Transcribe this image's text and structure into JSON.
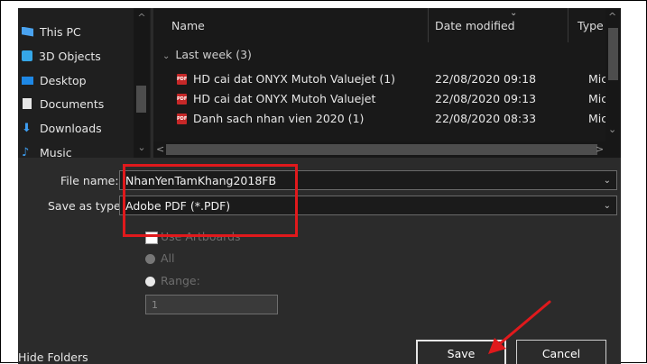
{
  "nav": {
    "items": [
      {
        "label": "This PC",
        "icon": "computer-icon"
      },
      {
        "label": "3D Objects",
        "icon": "cube-icon"
      },
      {
        "label": "Desktop",
        "icon": "desktop-icon"
      },
      {
        "label": "Documents",
        "icon": "document-icon"
      },
      {
        "label": "Downloads",
        "icon": "download-arrow-icon"
      },
      {
        "label": "Music",
        "icon": "music-note-icon"
      }
    ]
  },
  "list": {
    "columns": [
      "Name",
      "Date modified",
      "Type"
    ],
    "group_label": "Last week (3)",
    "rows": [
      {
        "name": "HD cai dat ONYX Mutoh Valuejet (1)",
        "date": "22/08/2020 09:18",
        "type": "Micro"
      },
      {
        "name": "HD cai dat ONYX Mutoh Valuejet",
        "date": "22/08/2020 09:13",
        "type": "Micro"
      },
      {
        "name": "Danh sach nhan vien 2020 (1)",
        "date": "22/08/2020 08:33",
        "type": "Micro"
      }
    ]
  },
  "form": {
    "file_name_label": "File name:",
    "file_name_value": "NhanYenTamKhang2018FB",
    "save_type_label": "Save as type:",
    "save_type_value": "Adobe PDF (*.PDF)",
    "use_artboards_label": "Use Artboards",
    "all_label": "All",
    "range_label": "Range:",
    "range_value": "1"
  },
  "footer": {
    "hide_folders": "Hide Folders",
    "save": "Save",
    "cancel": "Cancel"
  },
  "colors": {
    "dialog_bg": "#2b2b2b",
    "annotation": "#e0191c",
    "pdf_icon": "#c62828"
  }
}
